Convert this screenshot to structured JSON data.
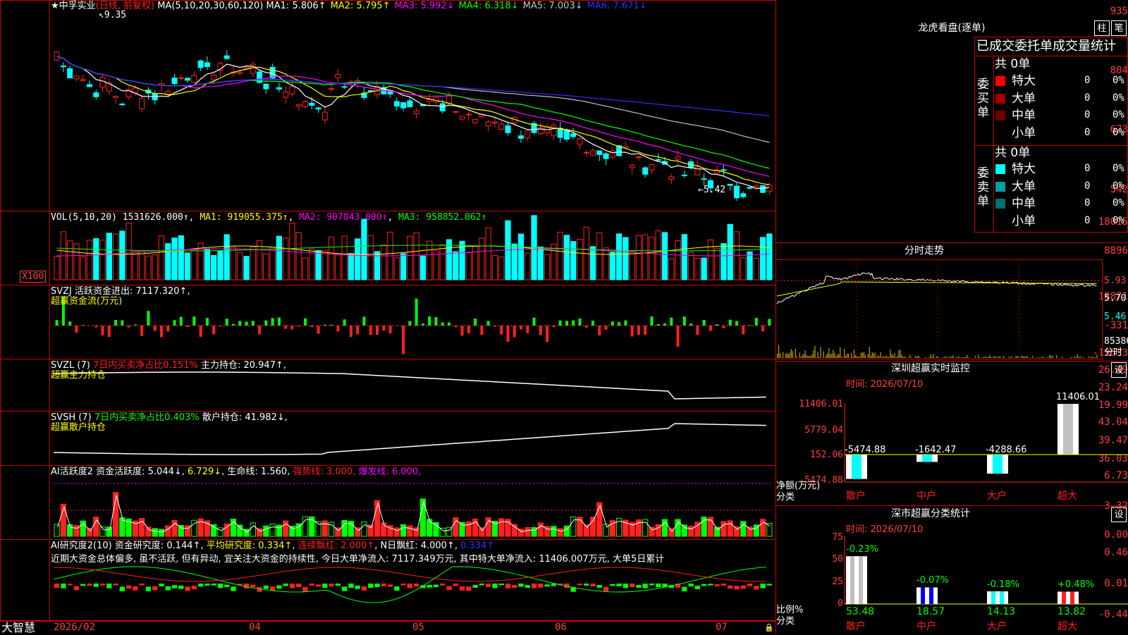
{
  "stock": {
    "name": "中孚实业",
    "period": "(日线, 前复权)",
    "ma_label": "MA(5,10,20,30,60,120)",
    "ma": [
      {
        "name": "MA1:",
        "value": "5.806↑",
        "color": "#ffffff"
      },
      {
        "name": "MA2:",
        "value": "5.795↑",
        "color": "#ffff00"
      },
      {
        "name": "MA3:",
        "value": "5.992↓",
        "color": "#ff00ff"
      },
      {
        "name": "MA4:",
        "value": "6.318↓",
        "color": "#00ff00"
      },
      {
        "name": "MA5:",
        "value": "7.003↓",
        "color": "#c0c0c0"
      },
      {
        "name": "MA6:",
        "value": "7.671↓",
        "color": "#3030ff"
      }
    ],
    "high_marker": "9.35",
    "low_marker": "←5.42",
    "price_axis": [
      "935",
      "804",
      "673",
      "542"
    ]
  },
  "vol": {
    "label": "VOL(5,10,20)",
    "value": "1531626.000↑",
    "ma1": "MA1: 919055.375↑",
    "ma2": "MA2: 907843.000↑",
    "ma3": "MA3: 958852.062↑",
    "axis": [
      "18015",
      "8896"
    ],
    "unit": "X100"
  },
  "svzj": {
    "label": "SVZJ  活跃资金进出: 7117.320↑,",
    "sub": "超赢资金流(万元)",
    "axis": [
      "18871",
      "-331",
      "-19533"
    ]
  },
  "svzl": {
    "label": "SVZL (7)",
    "ratio": "7日内买卖净占比0.151%",
    "hold": "主力持仓: 20.947↑,",
    "sub": "超赢主力持仓",
    "axis": [
      "26.49",
      "23.24",
      "19.99"
    ]
  },
  "svsh": {
    "label": "SVSH (7)",
    "ratio": "7日内买卖净占比0.403%",
    "hold": "散户持仓: 41.982↓,",
    "sub": "超赢散户持仓",
    "axis": [
      "43.04",
      "39.47",
      "36.03"
    ]
  },
  "ai1": {
    "label": "AI活跃度2",
    "a": "资金活跃度: 5.044↓",
    "b": "6.729↓",
    "c": "生命线: 1.560,",
    "d": "强势线: 3.000,",
    "e": "爆发线: 6.000,",
    "axis": [
      "6.73",
      "3.32",
      "0.00"
    ]
  },
  "ai2": {
    "label": "AI研究度2(10)",
    "a": "资金研究度: 0.144↑",
    "b": "平均研究度: 0.334↑",
    "c": "连续飘红: 2.000↑",
    "d": "N日飘红: 4.000↑",
    "e": "0.334↑",
    "text": "近期大资金总体偏多, 虽不活跃, 但有异动, 宜关注大资金的持续性, 今日大单净流入: 7117.349万元, 其中特大单净流入: 11406.007万元, 大单5日累计",
    "axis": [
      "0.46",
      "0.01",
      "-0.44"
    ]
  },
  "bottom": {
    "brand": "大智慧",
    "dates": [
      "2026/02",
      "04",
      "05",
      "06",
      "07"
    ]
  },
  "lhb": {
    "title": "龙虎看盘(逐单)",
    "btn1": "柱",
    "btn2": "笔",
    "header": "已成交委托单成交量统计",
    "buy_label": "委买单",
    "sell_label": "委卖单",
    "buy_total": "共 0单",
    "sell_total": "共 0单",
    "buy_rows": [
      {
        "name": "特大",
        "count": "0",
        "pct": "0%",
        "color": "#ff0000"
      },
      {
        "name": "大单",
        "count": "0",
        "pct": "0%",
        "color": "#a00000"
      },
      {
        "name": "中单",
        "count": "0",
        "pct": "0%",
        "color": "#700000"
      },
      {
        "name": "小单",
        "count": "0",
        "pct": "0%",
        "color": ""
      }
    ],
    "sell_rows": [
      {
        "name": "特大",
        "count": "0",
        "pct": "0%",
        "color": "#00ffff"
      },
      {
        "name": "大单",
        "count": "0",
        "pct": "0%",
        "color": "#00a0a0"
      },
      {
        "name": "中单",
        "count": "0",
        "pct": "0%",
        "color": "#007070"
      },
      {
        "name": "小单",
        "count": "0",
        "pct": "0%",
        "color": ""
      }
    ]
  },
  "fenshi": {
    "title": "分时走势",
    "axis": [
      "5.93",
      "5.70",
      "5.46"
    ],
    "vol": "85386",
    "unit": "分时"
  },
  "sz_monitor": {
    "title": "深圳超赢实时监控",
    "btn": "设",
    "time": "时间: 2026/07/10",
    "axis": [
      "11406.01",
      "5779.04",
      "152.06",
      "-5474.88"
    ],
    "ylabel": "净额(万元)",
    "xlabel": "分类",
    "values": [
      "-5474.88",
      "-1642.47",
      "-4288.66",
      "11406.01"
    ],
    "cats": [
      "散户",
      "中户",
      "大户",
      "超大"
    ]
  },
  "sz_class": {
    "title": "深市超赢分类统计",
    "btn": "设",
    "time": "时间: 2026/07/10",
    "axis": [
      "75",
      "50",
      "25",
      "0"
    ],
    "ylabel": "比例%",
    "xlabel": "分类",
    "changes": [
      "-0.23%",
      "-0.07%",
      "-0.18%",
      "+0.48%"
    ],
    "values": [
      "53.48",
      "18.57",
      "14.13",
      "13.82"
    ],
    "cats": [
      "散户",
      "中户",
      "大户",
      "超大"
    ]
  }
}
